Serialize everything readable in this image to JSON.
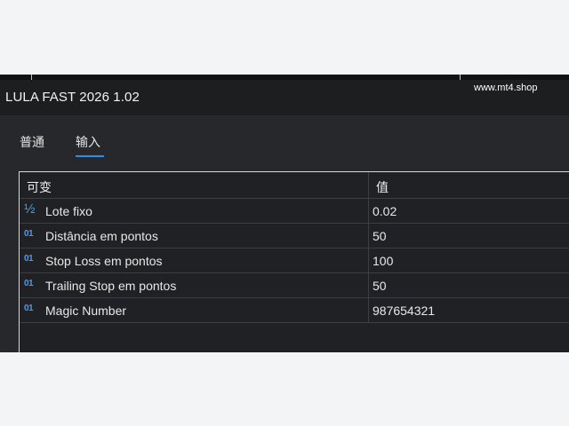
{
  "window": {
    "title": "LULA FAST 2026 1.02",
    "watermark": "www.mt4.shop"
  },
  "tabs": [
    {
      "label": "普通",
      "active": false
    },
    {
      "label": "输入",
      "active": true
    }
  ],
  "inputs_table": {
    "headers": [
      "可变",
      "值"
    ],
    "rows": [
      {
        "icon": "fraction-icon",
        "icon_text": "½",
        "name": "Lote fixo",
        "value": "0.02"
      },
      {
        "icon": "integer-icon",
        "icon_text": "01",
        "name": "Distância em pontos",
        "value": "50"
      },
      {
        "icon": "integer-icon",
        "icon_text": "01",
        "name": "Stop Loss em pontos",
        "value": "100"
      },
      {
        "icon": "integer-icon",
        "icon_text": "01",
        "name": "Trailing Stop em pontos",
        "value": "50"
      },
      {
        "icon": "integer-icon",
        "icon_text": "01",
        "name": "Magic Number",
        "value": "987654321"
      }
    ]
  },
  "colors": {
    "accent": "#2f8ce8",
    "icon": "#4f9ae6",
    "window_bg": "#27282b",
    "titlebar_bg": "#1d1e20"
  }
}
